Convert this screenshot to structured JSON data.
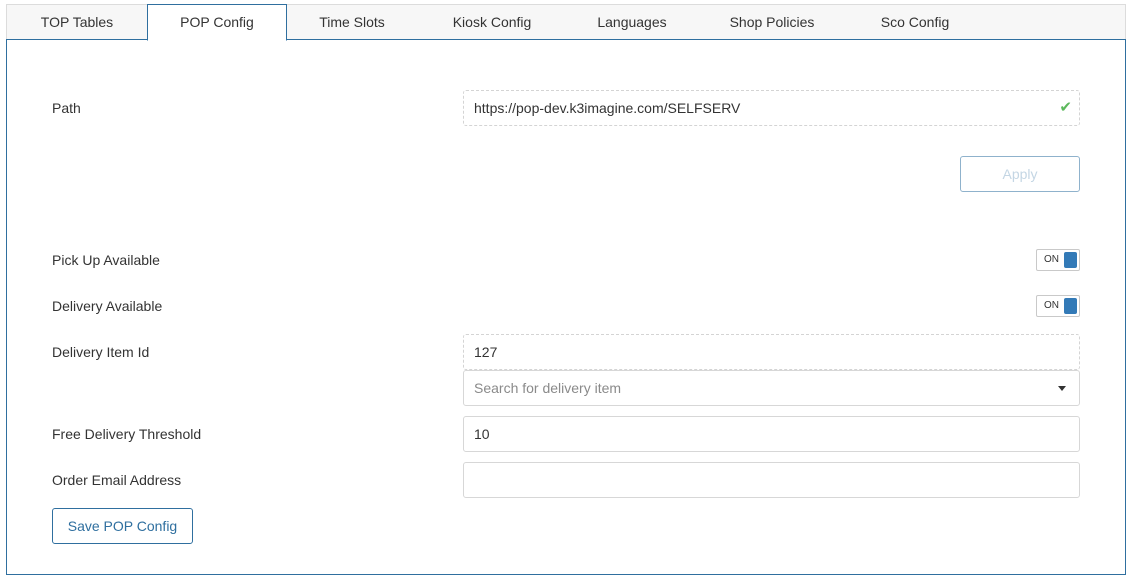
{
  "tabs": [
    {
      "label": "TOP Tables",
      "active": false
    },
    {
      "label": "POP Config",
      "active": true
    },
    {
      "label": "Time Slots",
      "active": false
    },
    {
      "label": "Kiosk Config",
      "active": false
    },
    {
      "label": "Languages",
      "active": false
    },
    {
      "label": "Shop Policies",
      "active": false
    },
    {
      "label": "Sco Config",
      "active": false
    }
  ],
  "form": {
    "path": {
      "label": "Path",
      "value": "https://pop-dev.k3imagine.com/SELFSERV",
      "valid_icon": "check-icon"
    },
    "apply_label": "Apply",
    "pickup": {
      "label": "Pick Up Available",
      "toggle_text": "ON",
      "checked": true
    },
    "delivery": {
      "label": "Delivery Available",
      "toggle_text": "ON",
      "checked": true
    },
    "delivery_item": {
      "label": "Delivery Item Id",
      "value": "127",
      "search_placeholder": "Search for delivery item"
    },
    "free_delivery": {
      "label": "Free Delivery Threshold",
      "value": "10"
    },
    "order_email": {
      "label": "Order Email Address",
      "value": ""
    },
    "save_label": "Save POP Config"
  },
  "colors": {
    "accent": "#2f6f9f",
    "toggle_on": "#337ab7",
    "valid": "#5cb85c"
  }
}
